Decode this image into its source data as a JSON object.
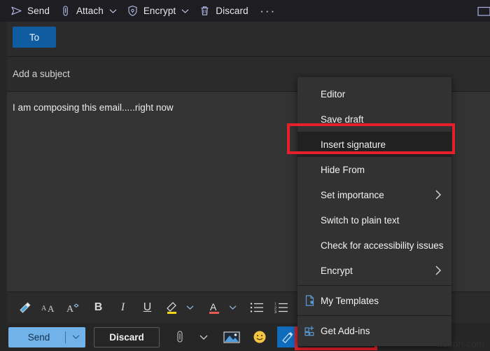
{
  "window": {
    "popout_icon": "popout-window-icon"
  },
  "toolbar": {
    "items": [
      {
        "label": "Send",
        "icon": "send-arrow-icon",
        "chevron": false
      },
      {
        "label": "Attach",
        "icon": "paperclip-icon",
        "chevron": true
      },
      {
        "label": "Encrypt",
        "icon": "shield-lock-icon",
        "chevron": true
      },
      {
        "label": "Discard",
        "icon": "trash-icon",
        "chevron": false
      }
    ],
    "overflow_label": "···"
  },
  "compose": {
    "to_label": "To",
    "subject_placeholder": "Add a subject",
    "body_text": "I am composing this email.....right now"
  },
  "format_toolbar": {
    "items": [
      {
        "name": "format-painter-icon",
        "glyph": ""
      },
      {
        "name": "font-size-icon",
        "glyph": ""
      },
      {
        "name": "font-effects-icon",
        "glyph": ""
      },
      {
        "name": "bold-icon",
        "glyph": "B"
      },
      {
        "name": "italic-icon",
        "glyph": "I"
      },
      {
        "name": "underline-icon",
        "glyph": "U"
      },
      {
        "name": "highlight-icon",
        "glyph": ""
      },
      {
        "name": "font-color-icon",
        "glyph": ""
      },
      {
        "name": "bulleted-list-icon",
        "glyph": ""
      },
      {
        "name": "numbered-list-icon",
        "glyph": ""
      },
      {
        "name": "decrease-indent-icon",
        "glyph": ""
      }
    ]
  },
  "actions": {
    "send_label": "Send",
    "discard_label": "Discard",
    "more_label": "···",
    "icons": [
      "paperclip-icon",
      "chevron-down-icon",
      "insert-picture-icon",
      "emoji-icon",
      "signature-icon",
      "brightness-icon"
    ]
  },
  "context_menu": {
    "items": [
      {
        "label": "Editor",
        "submenu": false,
        "icon": null,
        "selected": false,
        "divider_before": false
      },
      {
        "label": "Save draft",
        "submenu": false,
        "icon": null,
        "selected": false,
        "divider_before": false
      },
      {
        "label": "Insert signature",
        "submenu": false,
        "icon": null,
        "selected": true,
        "divider_before": false
      },
      {
        "label": "Hide From",
        "submenu": false,
        "icon": null,
        "selected": false,
        "divider_before": false
      },
      {
        "label": "Set importance",
        "submenu": true,
        "icon": null,
        "selected": false,
        "divider_before": false
      },
      {
        "label": "Switch to plain text",
        "submenu": false,
        "icon": null,
        "selected": false,
        "divider_before": false
      },
      {
        "label": "Check for accessibility issues",
        "submenu": false,
        "icon": null,
        "selected": false,
        "divider_before": false
      },
      {
        "label": "Encrypt",
        "submenu": true,
        "icon": null,
        "selected": false,
        "divider_before": false
      },
      {
        "label": "My Templates",
        "submenu": false,
        "icon": "template-icon",
        "selected": false,
        "divider_before": true
      },
      {
        "label": "Get Add-ins",
        "submenu": false,
        "icon": "add-ins-icon",
        "selected": false,
        "divider_before": true
      }
    ]
  },
  "highlights": {
    "menu_item": "Insert signature",
    "bottom_button": "more-options-button",
    "color": "#e51f2b"
  },
  "watermark": {
    "text": "wsxdn.com"
  },
  "colors": {
    "window_bg": "#262626",
    "topbar_bg": "#1e1e22",
    "field_bg": "#2b2b2b",
    "body_bg": "#333333",
    "menu_bg": "#323232",
    "menu_selected_bg": "#212121",
    "accent_blue": "#0f5ca0",
    "send_blue": "#71b2e8",
    "highlight_red": "#e51f2b"
  }
}
